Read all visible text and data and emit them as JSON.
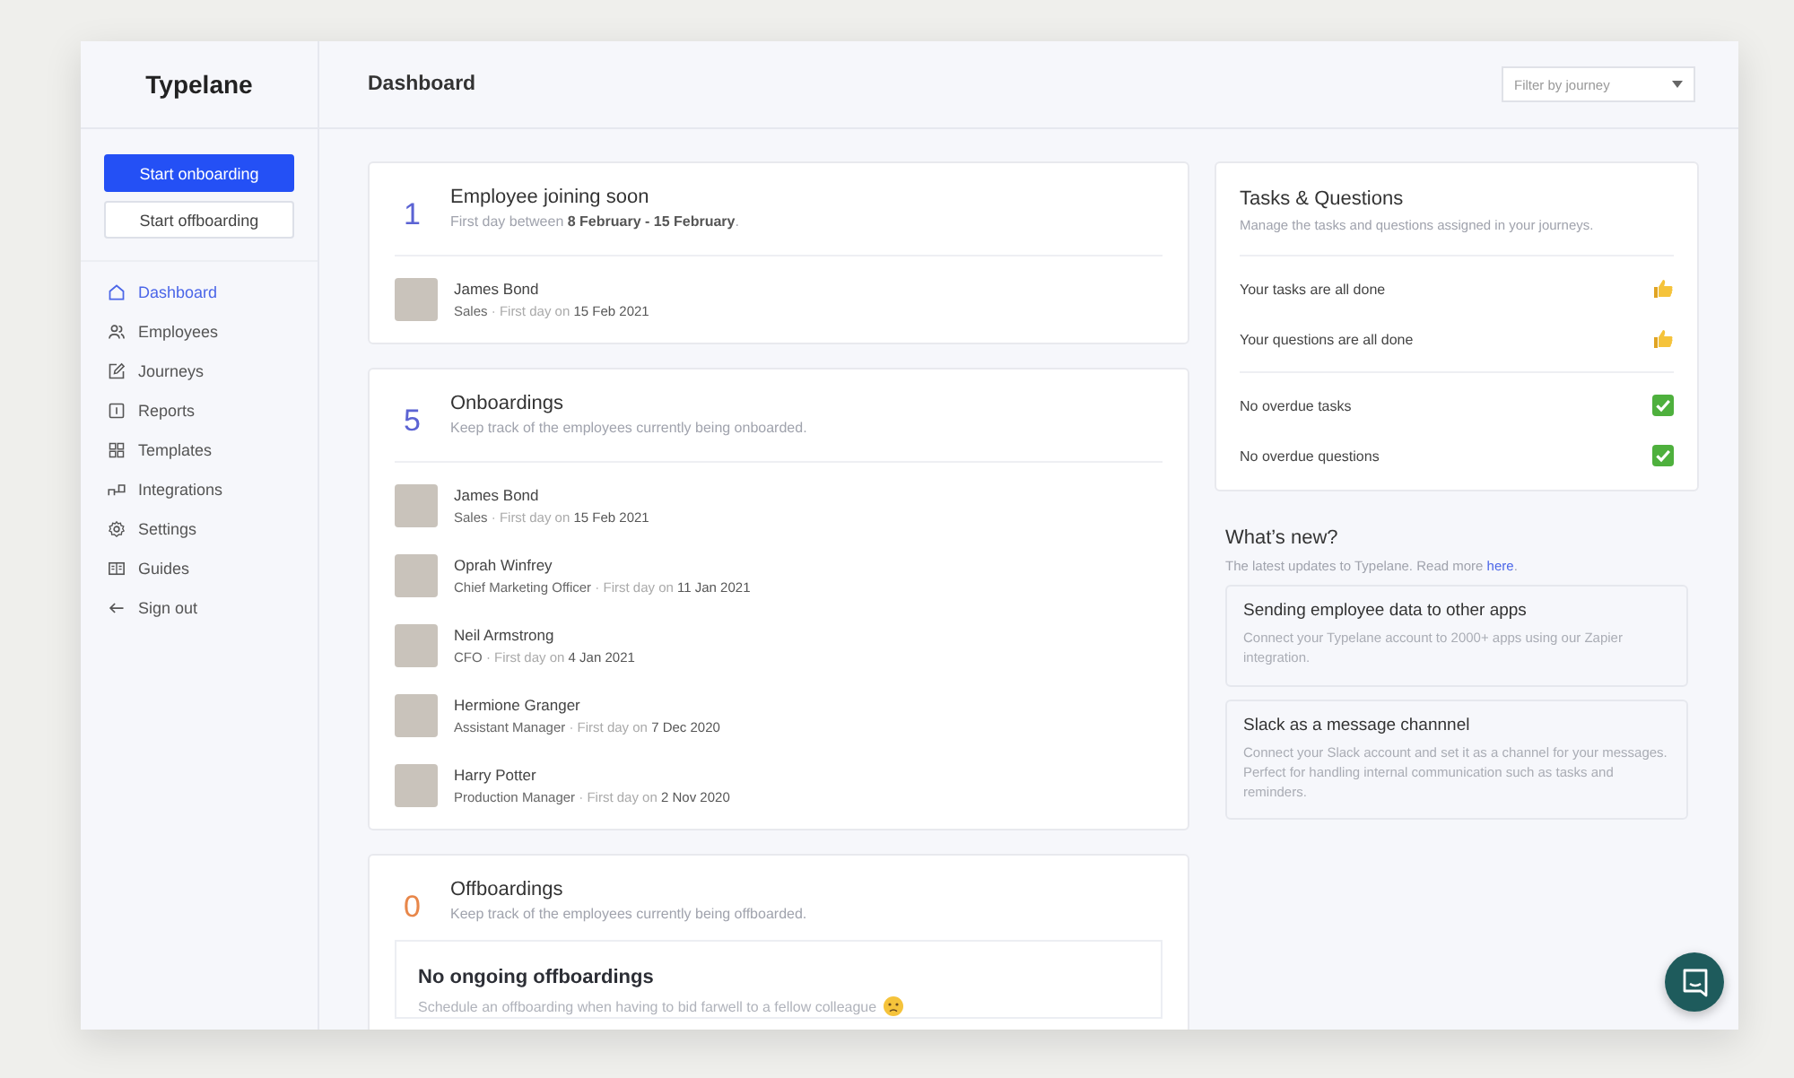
{
  "sidebar": {
    "logo": "Typelane",
    "buttons": [
      {
        "label": "Start onboarding",
        "kind": "primary"
      },
      {
        "label": "Start offboarding",
        "kind": "secondary"
      }
    ],
    "nav": [
      {
        "label": "Dashboard",
        "selected": true
      },
      {
        "label": "Employees",
        "selected": false
      },
      {
        "label": "Journeys",
        "selected": false
      },
      {
        "label": "Reports",
        "selected": false
      },
      {
        "label": "Templates",
        "selected": false
      },
      {
        "label": "Integrations",
        "selected": false
      },
      {
        "label": "Settings",
        "selected": false
      },
      {
        "label": "Guides",
        "selected": false
      },
      {
        "label": "Sign out",
        "selected": false
      }
    ]
  },
  "header": {
    "title": "Dashboard",
    "filter": {
      "placeholder": "Filter by journey"
    }
  },
  "cards": [
    {
      "count": "1",
      "color": "#5b63d3",
      "title": "Employee joining soon",
      "subtitle": "First day between **8 February - 15 February**.",
      "employees": [
        {
          "name": "James Bond",
          "role": "Sales",
          "detail": "· First day on **15 Feb 2021**"
        }
      ]
    },
    {
      "count": "5",
      "color": "#5b63d3",
      "title": "Onboardings",
      "subtitle": "Keep track of the employees currently being onboarded.",
      "employees": [
        {
          "name": "James Bond",
          "role": "Sales",
          "detail": "· First day on **15 Feb 2021**"
        },
        {
          "name": "Oprah Winfrey",
          "role": "Chief Marketing Officer",
          "detail": "· First day on **11 Jan 2021**"
        },
        {
          "name": "Neil Armstrong",
          "role": "CFO",
          "detail": "· First day on **4 Jan 2021**"
        },
        {
          "name": "Hermione Granger",
          "role": "Assistant Manager",
          "detail": "· First day on **7 Dec 2020**"
        },
        {
          "name": "Harry Potter",
          "role": "Production Manager",
          "detail": "· First day on **2 Nov 2020**"
        }
      ]
    },
    {
      "count": "0",
      "color": "#e8874a",
      "title": "Offboardings",
      "subtitle": "Keep track of the employees currently being offboarded.",
      "empty": {
        "title": "No ongoing offboardings",
        "text": "Schedule an offboarding when having to bid farwell to a fellow colleague"
      }
    }
  ],
  "tasks": {
    "title": "Tasks & Questions",
    "subtitle": "Manage the tasks and questions assigned in your journeys.",
    "groups": [
      {
        "items": [
          "Your tasks are all done",
          "Your questions are all done"
        ]
      },
      {
        "items": [
          "No overdue tasks",
          "No overdue questions"
        ]
      }
    ]
  },
  "whats_new": {
    "title": "What’s new?",
    "intro": "The latest updates to Typelane. Read more",
    "link": "here",
    "end": ".",
    "items": [
      {
        "title": "Sending employee data to other apps",
        "text": "Connect your Typelane account to 2000+ apps using our Zapier integration."
      },
      {
        "title": "Slack as a message channnel",
        "text": "Connect your Slack account and set it as a channel for your messages. Perfect for handling internal communication such as tasks and reminders."
      }
    ]
  }
}
